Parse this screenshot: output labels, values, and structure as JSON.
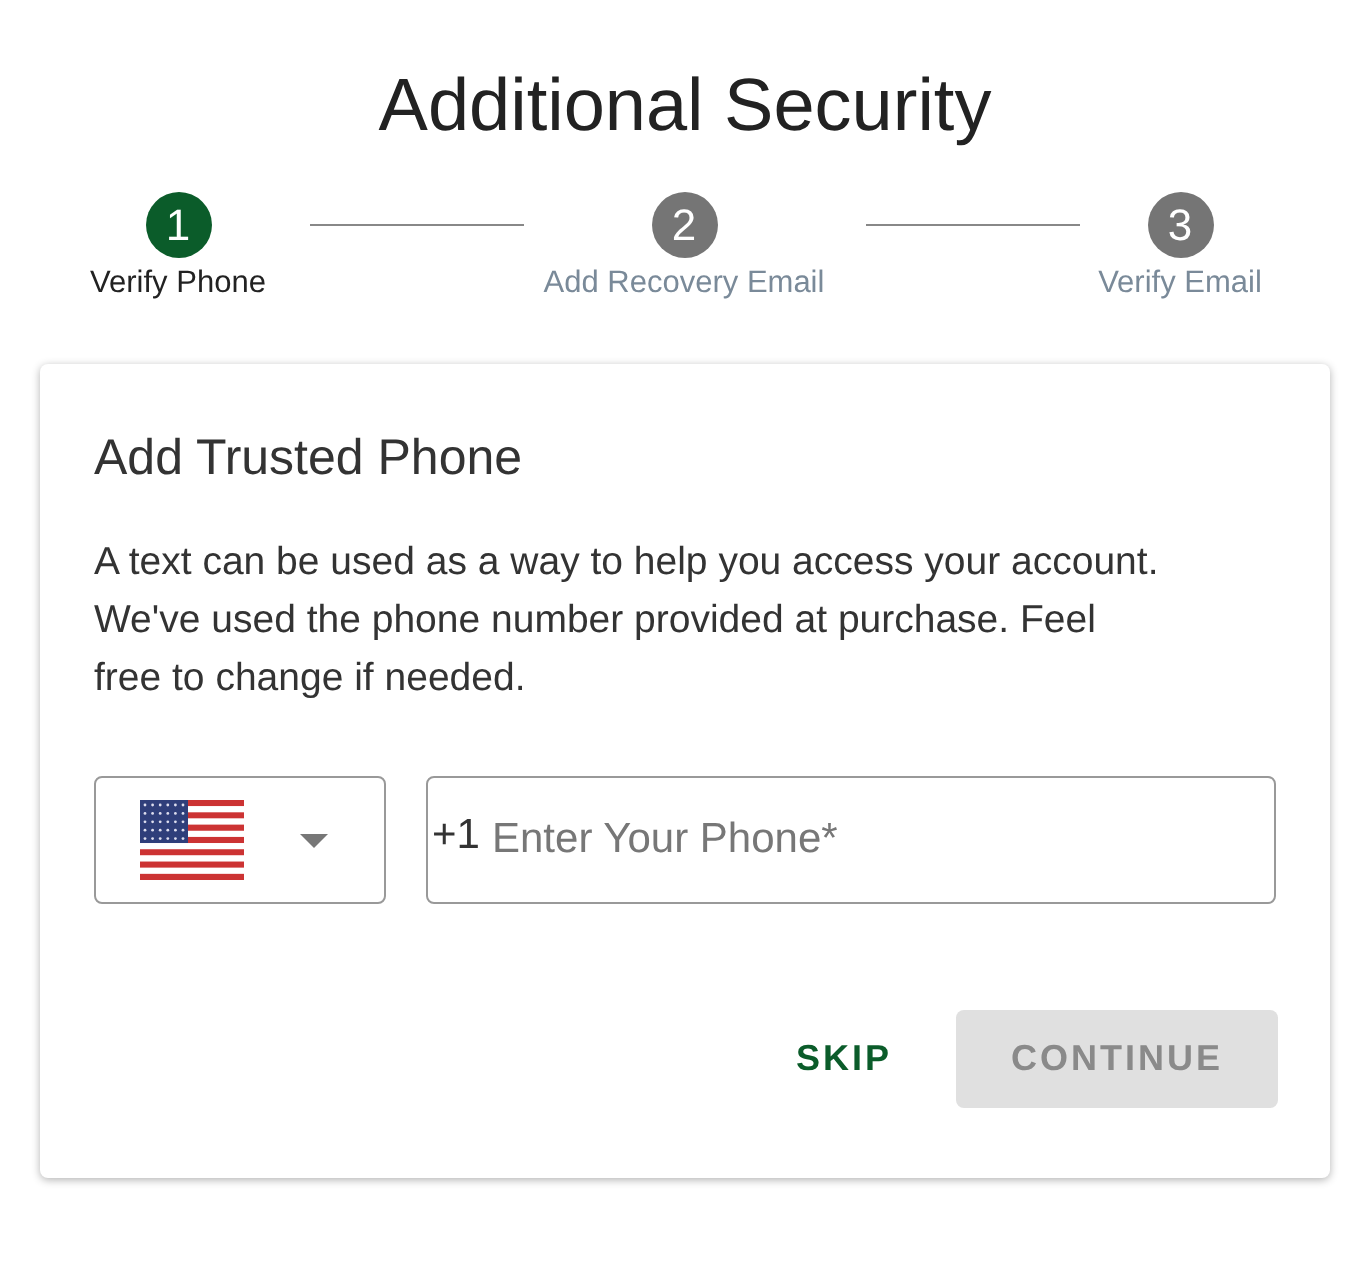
{
  "title": "Additional Security",
  "steps": [
    {
      "number": "1",
      "label": "Verify Phone",
      "selected": true
    },
    {
      "number": "2",
      "label": "Add Recovery Email",
      "selected": false
    },
    {
      "number": "3",
      "label": "Verify Email",
      "selected": false
    }
  ],
  "card": {
    "title": "Add Trusted Phone",
    "text": "A text can be used as a way to help you access your account. We've used the phone number provided at purchase. Feel free to change if needed.",
    "phone": {
      "prefix": "+1",
      "placeholder": "Enter Your Phone*"
    },
    "buttons": [
      {
        "label": "SKIP",
        "kind": "text",
        "disabled": false
      },
      {
        "label": "CONTINUE",
        "kind": "filled",
        "disabled": true
      }
    ]
  }
}
